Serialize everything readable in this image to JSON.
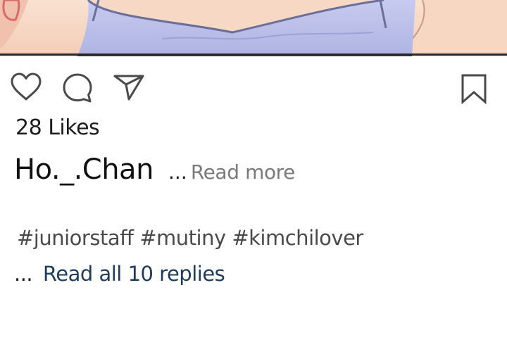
{
  "post": {
    "likes_text": "28 Likes",
    "username": "Ho._.Chan",
    "caption_ellipsis": "...",
    "read_more_label": "Read more",
    "hashtags_text": "#juniorstaff #mutiny #kimchilover",
    "replies_ellipsis": "...",
    "replies_label": "Read all 10 replies"
  },
  "icons": {
    "like": "heart-icon",
    "comment": "comment-bubble-icon",
    "share": "send-arrow-icon",
    "save": "bookmark-icon"
  },
  "colors": {
    "background": "#ffffff",
    "text_primary": "#1c1c1c",
    "read_more": "#7a7a7a",
    "hashtags": "#4a4a4a",
    "replies_link": "#1e3c5c",
    "icon_stroke": "#4a4a4a",
    "photo_skin": "#f6d8c4",
    "photo_top": "#b9bde8"
  }
}
